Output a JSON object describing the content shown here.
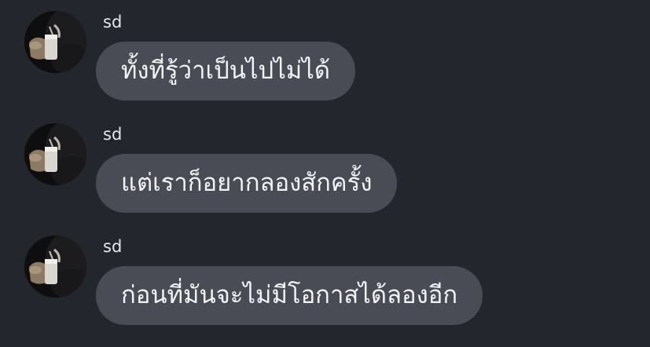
{
  "messages": [
    {
      "sender": "sd",
      "text": "ทั้งที่รู้ว่าเป็นไปไม่ได้"
    },
    {
      "sender": "sd",
      "text": "แต่เราก็อยากลองสักครั้ง"
    },
    {
      "sender": "sd",
      "text": "ก่อนที่มันจะไม่มีโอกาสได้ลองอีก"
    }
  ]
}
